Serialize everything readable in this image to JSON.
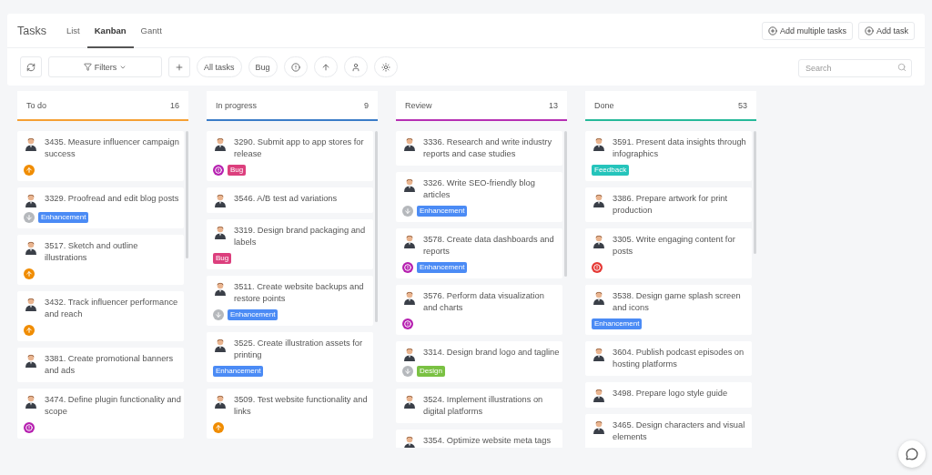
{
  "header": {
    "title": "Tasks",
    "tabs": [
      {
        "label": "List",
        "selected": false
      },
      {
        "label": "Kanban",
        "selected": true
      },
      {
        "label": "Gantt",
        "selected": false
      }
    ],
    "actions": [
      "Add multiple tasks",
      "Add task"
    ]
  },
  "toolbar": {
    "filters": "Filters",
    "chips": [
      "All tasks",
      "Bug"
    ],
    "search": {
      "placeholder": "Search"
    }
  },
  "columns": [
    {
      "name": "To do",
      "count": "16",
      "color": "#f5a033",
      "cards": [
        {
          "title": "3435. Measure influencer campaign success",
          "kind": "high"
        },
        {
          "title": "3329. Proofread and edit blog posts",
          "kind": "low",
          "tags": [
            {
              "label": "Enhancement",
              "color": "#4b8bf5"
            }
          ]
        },
        {
          "title": "3517. Sketch and outline illustrations",
          "kind": "high"
        },
        {
          "title": "3432. Track influencer performance and reach",
          "kind": "high"
        },
        {
          "title": "3381. Create promotional banners and ads"
        },
        {
          "title": "3474. Define plugin functionality and scope",
          "kind": "urgent"
        }
      ]
    },
    {
      "name": "In progress",
      "count": "9",
      "color": "#3a7cc8",
      "cards": [
        {
          "title": "3290. Submit app to app stores for release",
          "kind": "urgent",
          "tags": [
            {
              "label": "Bug",
              "color": "#dc3f7d"
            }
          ]
        },
        {
          "title": "3546. A/B test ad variations"
        },
        {
          "title": "3319. Design brand packaging and labels",
          "tags": [
            {
              "label": "Bug",
              "color": "#dc3f7d"
            }
          ]
        },
        {
          "title": "3511. Create website backups and restore points",
          "kind": "low",
          "tags": [
            {
              "label": "Enhancement",
              "color": "#4b8bf5"
            }
          ]
        },
        {
          "title": "3525. Create illustration assets for printing",
          "tags": [
            {
              "label": "Enhancement",
              "color": "#4b8bf5"
            }
          ]
        },
        {
          "title": "3509. Test website functionality and links",
          "kind": "high"
        }
      ]
    },
    {
      "name": "Review",
      "count": "13",
      "color": "#b62fb3",
      "cards": [
        {
          "title": "3336. Research and write industry reports and case studies"
        },
        {
          "title": "3326. Write SEO-friendly blog articles",
          "kind": "low",
          "tags": [
            {
              "label": "Enhancement",
              "color": "#4b8bf5"
            }
          ]
        },
        {
          "title": "3578. Create data dashboards and reports",
          "kind": "urgent",
          "tags": [
            {
              "label": "Enhancement",
              "color": "#4b8bf5"
            }
          ]
        },
        {
          "title": "3576. Perform data visualization and charts",
          "kind": "urgent"
        },
        {
          "title": "3314. Design brand logo and tagline",
          "kind": "low",
          "tags": [
            {
              "label": "Design",
              "color": "#7ac143"
            }
          ]
        },
        {
          "title": "3524. Implement illustrations on digital platforms"
        },
        {
          "title": "3354. Optimize website meta tags"
        }
      ]
    },
    {
      "name": "Done",
      "count": "53",
      "color": "#26b99a",
      "cards": [
        {
          "title": "3591. Present data insights through infographics",
          "tags": [
            {
              "label": "Feedback",
              "color": "#25c4bb"
            }
          ]
        },
        {
          "title": "3386. Prepare artwork for print production"
        },
        {
          "title": "3305. Write engaging content for posts",
          "kind": "critical"
        },
        {
          "title": "3538. Design game splash screen and icons",
          "tags": [
            {
              "label": "Enhancement",
              "color": "#4b8bf5"
            }
          ]
        },
        {
          "title": "3604. Publish podcast episodes on hosting platforms"
        },
        {
          "title": "3498. Prepare logo style guide"
        },
        {
          "title": "3465. Design characters and visual elements"
        }
      ]
    }
  ]
}
